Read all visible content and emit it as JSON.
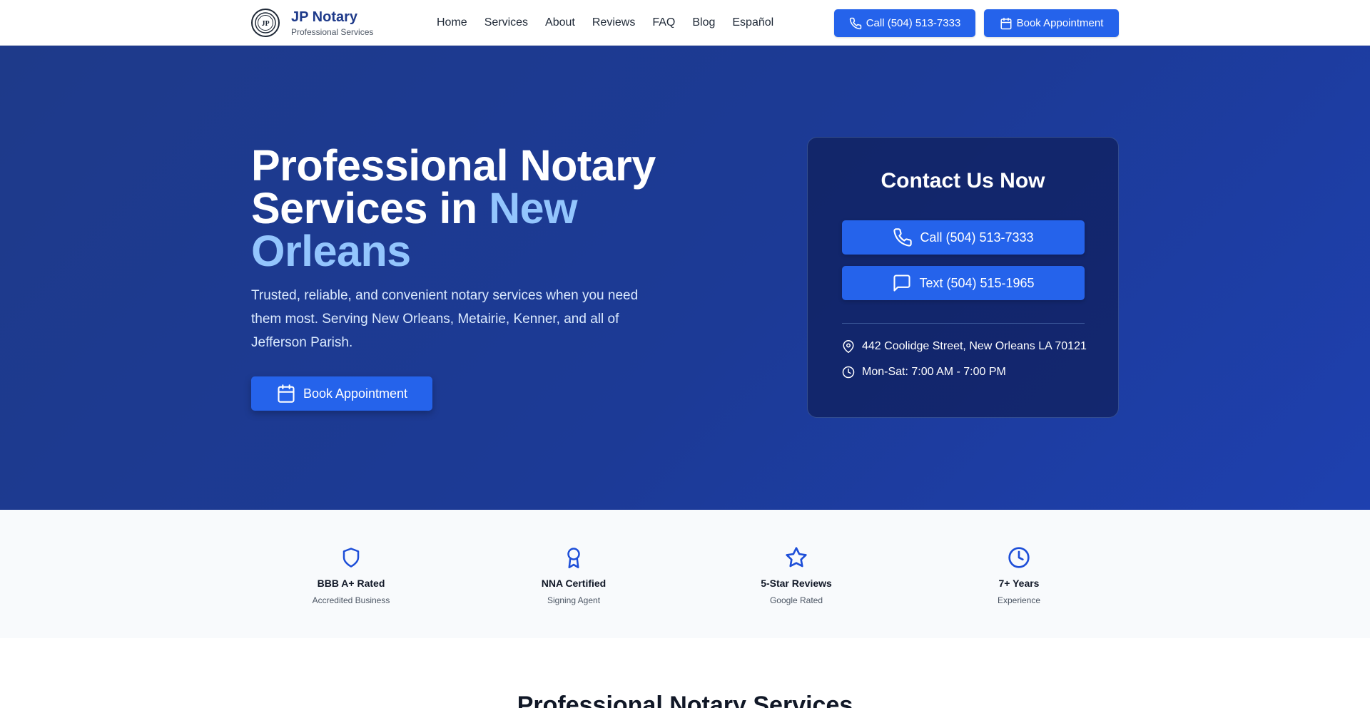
{
  "header": {
    "brand_name": "JP Notary",
    "brand_sub": "Professional Services",
    "nav": [
      "Home",
      "Services",
      "About",
      "Reviews",
      "FAQ",
      "Blog",
      "Español"
    ],
    "call_label": "Call (504) 513-7333",
    "book_label": "Book Appointment"
  },
  "hero": {
    "title_line1": "Professional Notary",
    "title_line2": "Services in ",
    "title_accent": "New Orleans",
    "description": "Trusted, reliable, and convenient notary services when you need them most. Serving New Orleans, Metairie, Kenner, and all of Jefferson Parish.",
    "book_label": "Book Appointment"
  },
  "contact": {
    "title": "Contact Us Now",
    "call_label": "Call (504) 513-7333",
    "text_label": "Text (504) 515-1965",
    "address": "442 Coolidge Street, New Orleans LA 70121",
    "hours": "Mon-Sat: 7:00 AM - 7:00 PM"
  },
  "trust": [
    {
      "icon": "shield-icon",
      "title": "BBB A+ Rated",
      "sub": "Accredited Business"
    },
    {
      "icon": "award-icon",
      "title": "NNA Certified",
      "sub": "Signing Agent"
    },
    {
      "icon": "star-icon",
      "title": "5-Star Reviews",
      "sub": "Google Rated"
    },
    {
      "icon": "clock-icon",
      "title": "7+ Years",
      "sub": "Experience"
    }
  ],
  "section": {
    "title": "Professional Notary Services"
  },
  "colors": {
    "primary": "#2563eb",
    "hero_bg": "#1e3a8a",
    "accent_text": "#93c5fd",
    "brand_text": "#1e3a8a"
  }
}
